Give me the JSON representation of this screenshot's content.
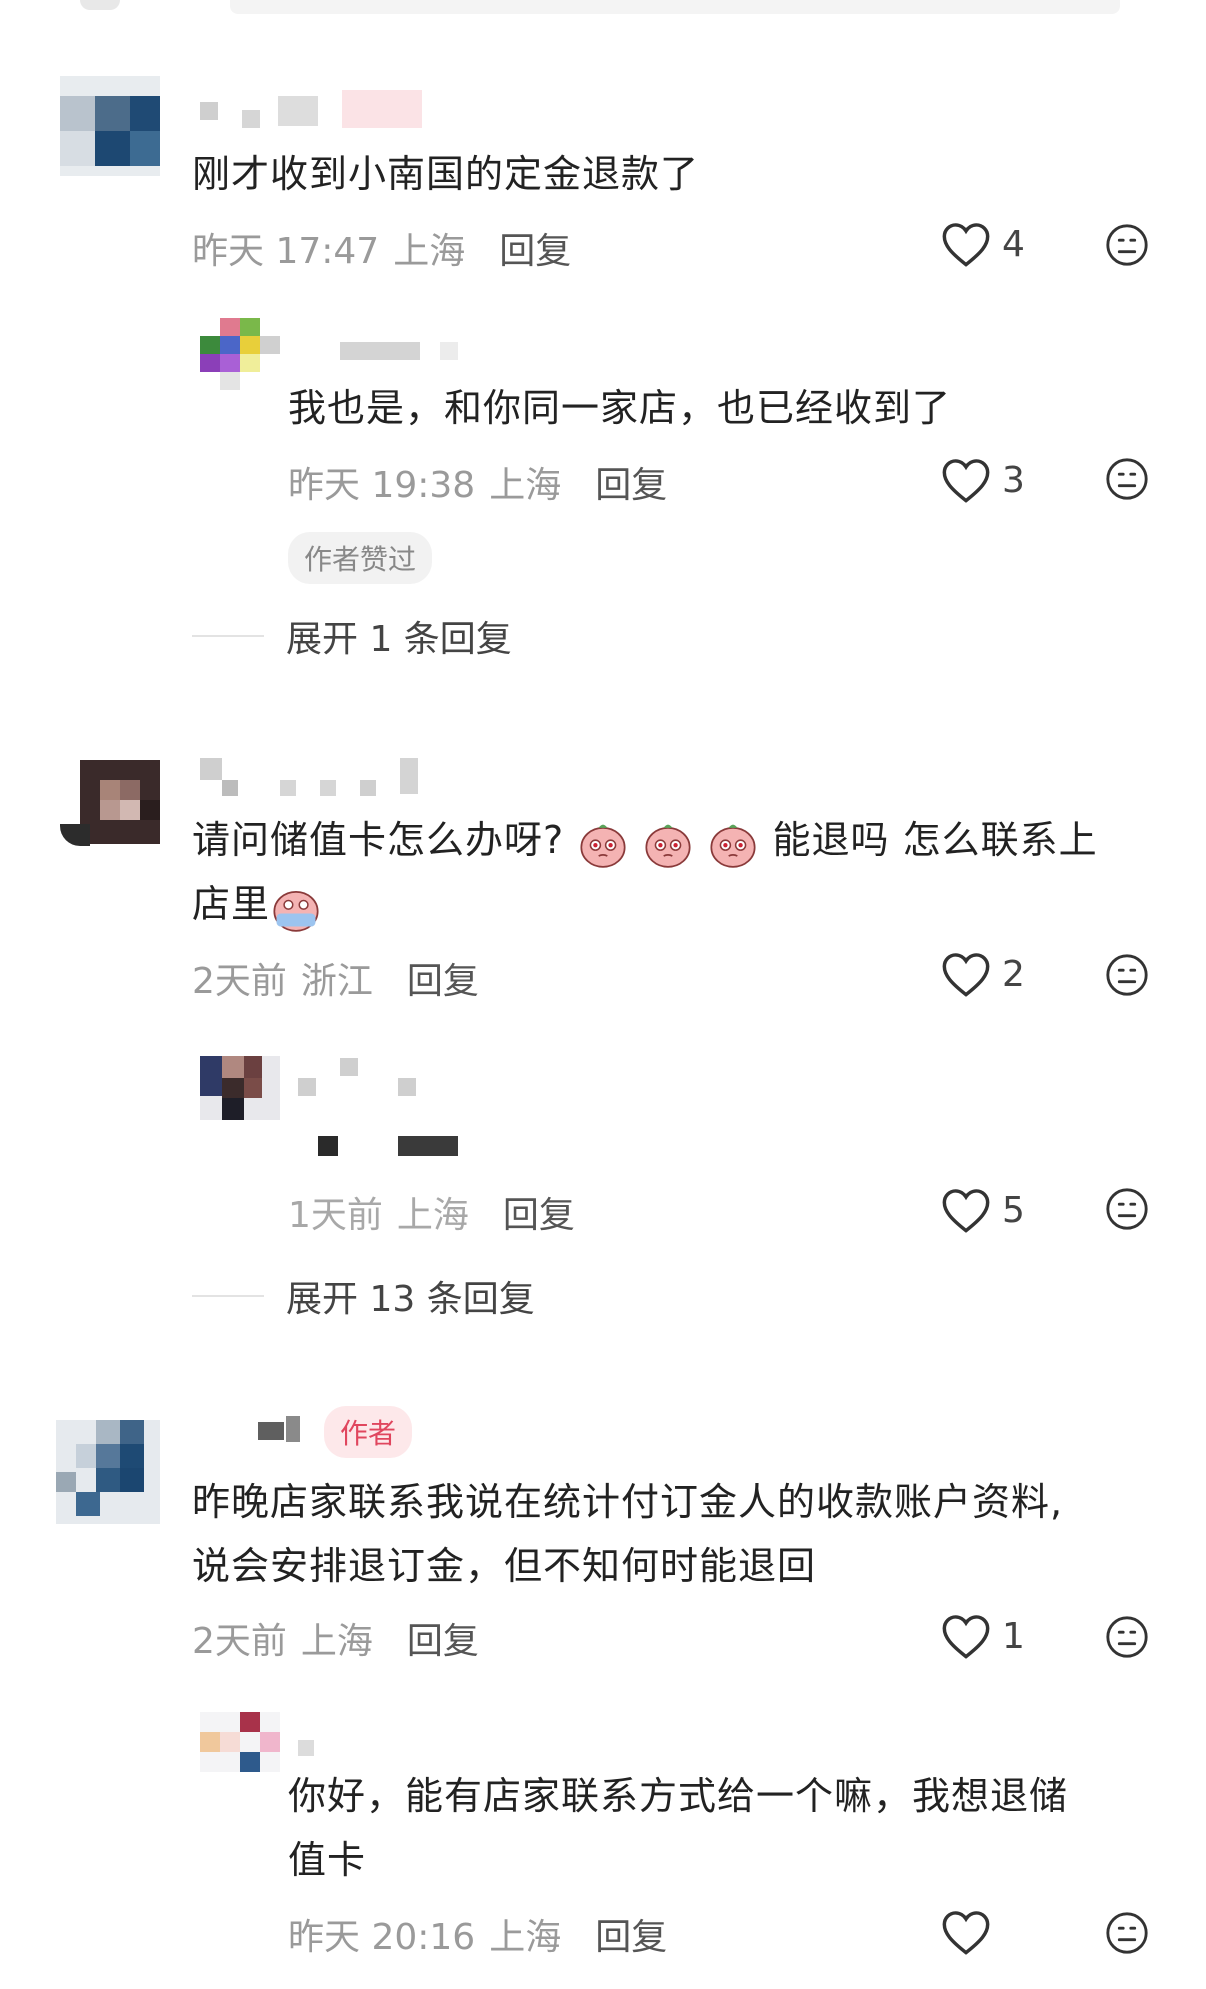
{
  "comments": [
    {
      "text": "刚才收到小南国的定金退款了",
      "time": "昨天 17:47",
      "location": "上海",
      "reply_label": "回复",
      "likes": "4"
    },
    {
      "text": "我也是，和你同一家店，也已经收到了",
      "time": "昨天 19:38",
      "location": "上海",
      "reply_label": "回复",
      "likes": "3",
      "badge": "作者赞过",
      "expand": "展开 1 条回复"
    },
    {
      "text_line1_a": "请问储值卡怎么办呀?",
      "text_line1_b": "能退吗 怎么联系上",
      "text_line2": "店里",
      "time": "2天前",
      "location": "浙江",
      "reply_label": "回复",
      "likes": "2"
    },
    {
      "time": "1天前",
      "location": "上海",
      "reply_label": "回复",
      "likes": "5",
      "expand": "展开 13 条回复"
    },
    {
      "author_badge": "作者",
      "text_line1": "昨晚店家联系我说在统计付订金人的收款账户资料,",
      "text_line2": "说会安排退订金，但不知何时能退回",
      "time": "2天前",
      "location": "上海",
      "reply_label": "回复",
      "likes": "1"
    },
    {
      "text_line1": "你好，能有店家联系方式给一个嘛，我想退储",
      "text_line2": "值卡",
      "time": "昨天 20:16",
      "location": "上海",
      "reply_label": "回复"
    }
  ],
  "icons": {
    "like": "heart-outline-icon",
    "dislike": "meh-face-icon",
    "emoji": "crying-peach-emoji"
  },
  "colors": {
    "author_badge_bg": "#fde8ea",
    "author_badge_text": "#e0465e",
    "meta_text": "#9a9a9a"
  }
}
